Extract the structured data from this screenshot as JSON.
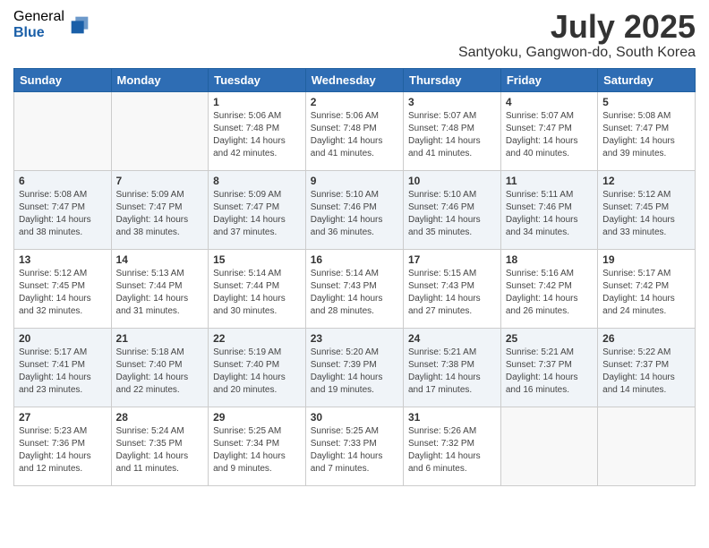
{
  "logo": {
    "general": "General",
    "blue": "Blue"
  },
  "title": {
    "month": "July 2025",
    "location": "Santyoku, Gangwon-do, South Korea"
  },
  "weekdays": [
    "Sunday",
    "Monday",
    "Tuesday",
    "Wednesday",
    "Thursday",
    "Friday",
    "Saturday"
  ],
  "weeks": [
    [
      {
        "day": "",
        "sunrise": "",
        "sunset": "",
        "daylight": ""
      },
      {
        "day": "",
        "sunrise": "",
        "sunset": "",
        "daylight": ""
      },
      {
        "day": "1",
        "sunrise": "Sunrise: 5:06 AM",
        "sunset": "Sunset: 7:48 PM",
        "daylight": "Daylight: 14 hours and 42 minutes."
      },
      {
        "day": "2",
        "sunrise": "Sunrise: 5:06 AM",
        "sunset": "Sunset: 7:48 PM",
        "daylight": "Daylight: 14 hours and 41 minutes."
      },
      {
        "day": "3",
        "sunrise": "Sunrise: 5:07 AM",
        "sunset": "Sunset: 7:48 PM",
        "daylight": "Daylight: 14 hours and 41 minutes."
      },
      {
        "day": "4",
        "sunrise": "Sunrise: 5:07 AM",
        "sunset": "Sunset: 7:47 PM",
        "daylight": "Daylight: 14 hours and 40 minutes."
      },
      {
        "day": "5",
        "sunrise": "Sunrise: 5:08 AM",
        "sunset": "Sunset: 7:47 PM",
        "daylight": "Daylight: 14 hours and 39 minutes."
      }
    ],
    [
      {
        "day": "6",
        "sunrise": "Sunrise: 5:08 AM",
        "sunset": "Sunset: 7:47 PM",
        "daylight": "Daylight: 14 hours and 38 minutes."
      },
      {
        "day": "7",
        "sunrise": "Sunrise: 5:09 AM",
        "sunset": "Sunset: 7:47 PM",
        "daylight": "Daylight: 14 hours and 38 minutes."
      },
      {
        "day": "8",
        "sunrise": "Sunrise: 5:09 AM",
        "sunset": "Sunset: 7:47 PM",
        "daylight": "Daylight: 14 hours and 37 minutes."
      },
      {
        "day": "9",
        "sunrise": "Sunrise: 5:10 AM",
        "sunset": "Sunset: 7:46 PM",
        "daylight": "Daylight: 14 hours and 36 minutes."
      },
      {
        "day": "10",
        "sunrise": "Sunrise: 5:10 AM",
        "sunset": "Sunset: 7:46 PM",
        "daylight": "Daylight: 14 hours and 35 minutes."
      },
      {
        "day": "11",
        "sunrise": "Sunrise: 5:11 AM",
        "sunset": "Sunset: 7:46 PM",
        "daylight": "Daylight: 14 hours and 34 minutes."
      },
      {
        "day": "12",
        "sunrise": "Sunrise: 5:12 AM",
        "sunset": "Sunset: 7:45 PM",
        "daylight": "Daylight: 14 hours and 33 minutes."
      }
    ],
    [
      {
        "day": "13",
        "sunrise": "Sunrise: 5:12 AM",
        "sunset": "Sunset: 7:45 PM",
        "daylight": "Daylight: 14 hours and 32 minutes."
      },
      {
        "day": "14",
        "sunrise": "Sunrise: 5:13 AM",
        "sunset": "Sunset: 7:44 PM",
        "daylight": "Daylight: 14 hours and 31 minutes."
      },
      {
        "day": "15",
        "sunrise": "Sunrise: 5:14 AM",
        "sunset": "Sunset: 7:44 PM",
        "daylight": "Daylight: 14 hours and 30 minutes."
      },
      {
        "day": "16",
        "sunrise": "Sunrise: 5:14 AM",
        "sunset": "Sunset: 7:43 PM",
        "daylight": "Daylight: 14 hours and 28 minutes."
      },
      {
        "day": "17",
        "sunrise": "Sunrise: 5:15 AM",
        "sunset": "Sunset: 7:43 PM",
        "daylight": "Daylight: 14 hours and 27 minutes."
      },
      {
        "day": "18",
        "sunrise": "Sunrise: 5:16 AM",
        "sunset": "Sunset: 7:42 PM",
        "daylight": "Daylight: 14 hours and 26 minutes."
      },
      {
        "day": "19",
        "sunrise": "Sunrise: 5:17 AM",
        "sunset": "Sunset: 7:42 PM",
        "daylight": "Daylight: 14 hours and 24 minutes."
      }
    ],
    [
      {
        "day": "20",
        "sunrise": "Sunrise: 5:17 AM",
        "sunset": "Sunset: 7:41 PM",
        "daylight": "Daylight: 14 hours and 23 minutes."
      },
      {
        "day": "21",
        "sunrise": "Sunrise: 5:18 AM",
        "sunset": "Sunset: 7:40 PM",
        "daylight": "Daylight: 14 hours and 22 minutes."
      },
      {
        "day": "22",
        "sunrise": "Sunrise: 5:19 AM",
        "sunset": "Sunset: 7:40 PM",
        "daylight": "Daylight: 14 hours and 20 minutes."
      },
      {
        "day": "23",
        "sunrise": "Sunrise: 5:20 AM",
        "sunset": "Sunset: 7:39 PM",
        "daylight": "Daylight: 14 hours and 19 minutes."
      },
      {
        "day": "24",
        "sunrise": "Sunrise: 5:21 AM",
        "sunset": "Sunset: 7:38 PM",
        "daylight": "Daylight: 14 hours and 17 minutes."
      },
      {
        "day": "25",
        "sunrise": "Sunrise: 5:21 AM",
        "sunset": "Sunset: 7:37 PM",
        "daylight": "Daylight: 14 hours and 16 minutes."
      },
      {
        "day": "26",
        "sunrise": "Sunrise: 5:22 AM",
        "sunset": "Sunset: 7:37 PM",
        "daylight": "Daylight: 14 hours and 14 minutes."
      }
    ],
    [
      {
        "day": "27",
        "sunrise": "Sunrise: 5:23 AM",
        "sunset": "Sunset: 7:36 PM",
        "daylight": "Daylight: 14 hours and 12 minutes."
      },
      {
        "day": "28",
        "sunrise": "Sunrise: 5:24 AM",
        "sunset": "Sunset: 7:35 PM",
        "daylight": "Daylight: 14 hours and 11 minutes."
      },
      {
        "day": "29",
        "sunrise": "Sunrise: 5:25 AM",
        "sunset": "Sunset: 7:34 PM",
        "daylight": "Daylight: 14 hours and 9 minutes."
      },
      {
        "day": "30",
        "sunrise": "Sunrise: 5:25 AM",
        "sunset": "Sunset: 7:33 PM",
        "daylight": "Daylight: 14 hours and 7 minutes."
      },
      {
        "day": "31",
        "sunrise": "Sunrise: 5:26 AM",
        "sunset": "Sunset: 7:32 PM",
        "daylight": "Daylight: 14 hours and 6 minutes."
      },
      {
        "day": "",
        "sunrise": "",
        "sunset": "",
        "daylight": ""
      },
      {
        "day": "",
        "sunrise": "",
        "sunset": "",
        "daylight": ""
      }
    ]
  ]
}
